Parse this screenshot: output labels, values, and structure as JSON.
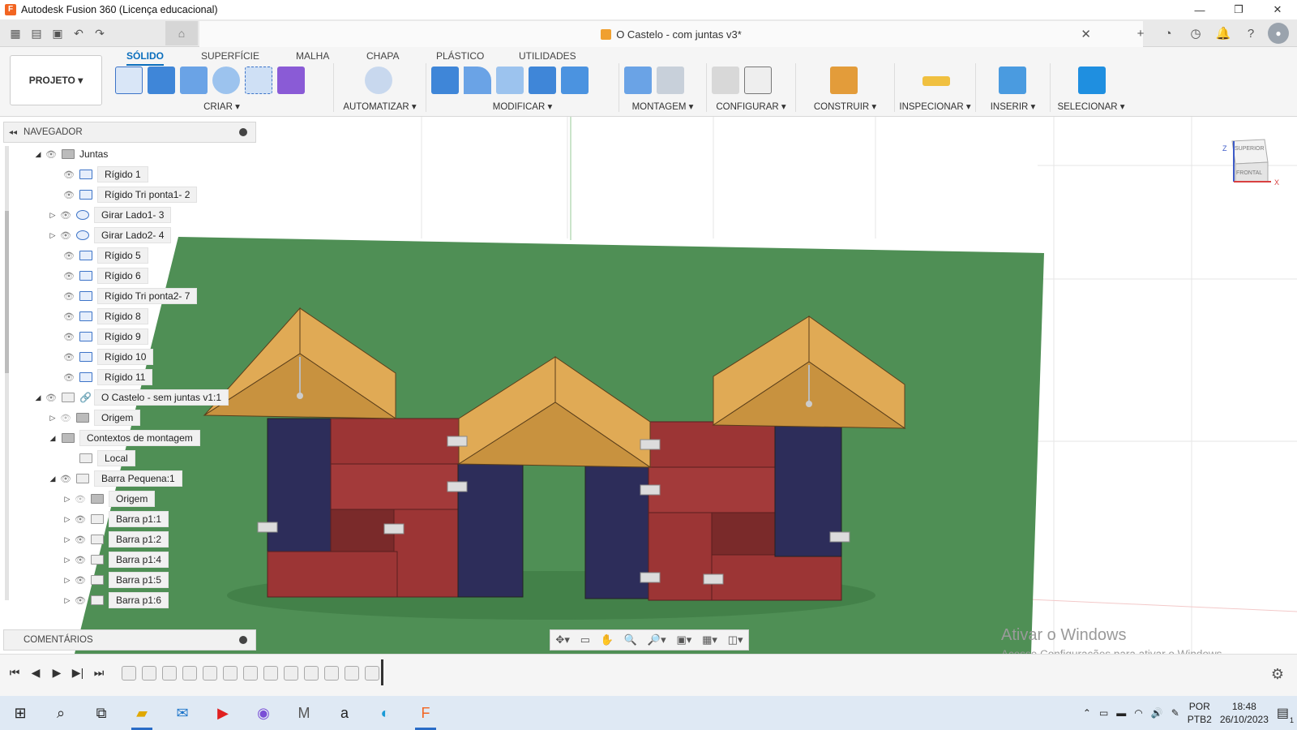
{
  "window": {
    "title": "Autodesk Fusion 360 (Licença educacional)",
    "controls": [
      "—",
      "❐",
      "✕"
    ]
  },
  "document": {
    "tab_title": "O Castelo - com juntas v3*",
    "close": "✕"
  },
  "ribbon": {
    "project_button": "PROJETO ▾",
    "tabs": [
      "SÓLIDO",
      "SUPERFÍCIE",
      "MALHA",
      "CHAPA",
      "PLÁSTICO",
      "UTILIDADES"
    ],
    "active_tab": "SÓLIDO",
    "groups": [
      "CRIAR ▾",
      "AUTOMATIZAR ▾",
      "MODIFICAR ▾",
      "MONTAGEM ▾",
      "CONFIGURAR ▾",
      "CONSTRUIR ▾",
      "INSPECIONAR ▾",
      "INSERIR ▾",
      "SELECIONAR ▾"
    ]
  },
  "navigator": {
    "title": "NAVEGADOR",
    "items": [
      {
        "label": "Juntas"
      },
      {
        "label": "Rígido 1"
      },
      {
        "label": "Rígido Tri ponta1- 2"
      },
      {
        "label": "Girar Lado1- 3"
      },
      {
        "label": "Girar Lado2- 4"
      },
      {
        "label": "Rígido 5"
      },
      {
        "label": "Rígido 6"
      },
      {
        "label": "Rígido Tri ponta2- 7"
      },
      {
        "label": "Rígido 8"
      },
      {
        "label": "Rígido 9"
      },
      {
        "label": "Rígido 10"
      },
      {
        "label": "Rígido 11"
      },
      {
        "label": "O Castelo - sem juntas v1:1"
      },
      {
        "label": "Origem"
      },
      {
        "label": "Contextos de montagem"
      },
      {
        "label": "Local"
      },
      {
        "label": "Barra Pequena:1"
      },
      {
        "label": "Origem"
      },
      {
        "label": "Barra p1:1"
      },
      {
        "label": "Barra p1:2"
      },
      {
        "label": "Barra p1:4"
      },
      {
        "label": "Barra p1:5"
      },
      {
        "label": "Barra p1:6"
      }
    ]
  },
  "comments": {
    "title": "COMENTÁRIOS"
  },
  "viewcube": {
    "top": "SUPERIOR",
    "front": "FRONTAL",
    "axis_z": "Z",
    "axis_x": "X"
  },
  "watermark": {
    "line1": "Ativar o Windows",
    "line2": "Acesse Configurações para ativar o Windows."
  },
  "taskbar": {
    "lang": "POR",
    "layout": "PTB2",
    "time": "18:48",
    "date": "26/10/2023",
    "notif_count": "1"
  },
  "colors": {
    "ground": "#4f8f55",
    "roof": "#e0aa55",
    "red_block": "#9c3535",
    "navy_block": "#2d2d5a",
    "accent": "#0a6ebd"
  }
}
